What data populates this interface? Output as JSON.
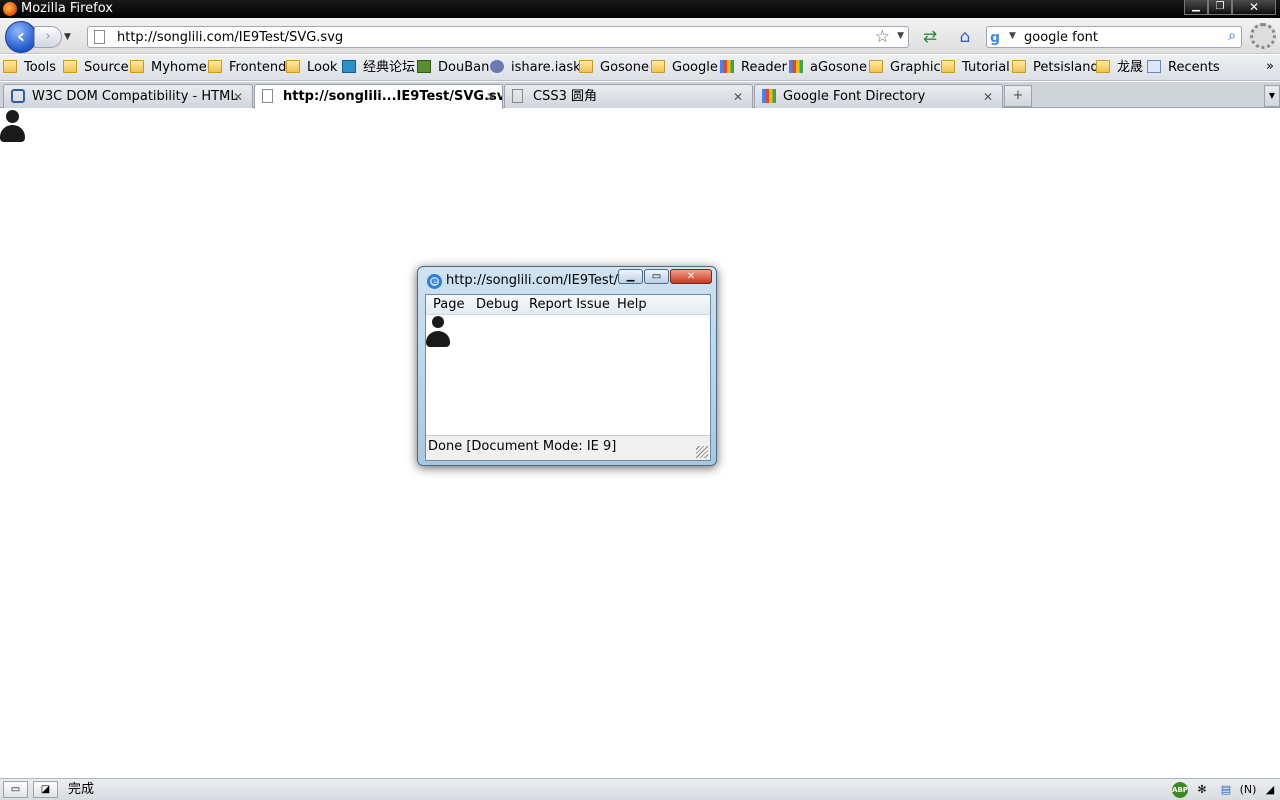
{
  "window": {
    "title": "Mozilla Firefox"
  },
  "nav": {
    "url": "http://songlili.com/IE9Test/SVG.svg",
    "search_text": "google font"
  },
  "bookmarks": [
    {
      "label": "Tools",
      "icon": "folder-icon"
    },
    {
      "label": "Source",
      "icon": "folder-icon"
    },
    {
      "label": "Myhome",
      "icon": "folder-icon"
    },
    {
      "label": "Frontend",
      "icon": "folder-icon"
    },
    {
      "label": "Look",
      "icon": "folder-icon"
    },
    {
      "label": "经典论坛",
      "icon": "site-icon"
    },
    {
      "label": "DouBan",
      "icon": "site-icon"
    },
    {
      "label": "ishare.iask",
      "icon": "site-icon"
    },
    {
      "label": "Gosone",
      "icon": "folder-icon"
    },
    {
      "label": "Google",
      "icon": "folder-icon"
    },
    {
      "label": "Reader",
      "icon": "google-icon"
    },
    {
      "label": "aGosone",
      "icon": "google-icon"
    },
    {
      "label": "Graphic",
      "icon": "folder-icon"
    },
    {
      "label": "Tutorial",
      "icon": "folder-icon"
    },
    {
      "label": "Petsisland",
      "icon": "folder-icon"
    },
    {
      "label": "龙晟",
      "icon": "folder-icon"
    },
    {
      "label": "Recents",
      "icon": "site-icon"
    }
  ],
  "tabs": [
    {
      "label": "W3C DOM Compatibility - HTML",
      "active": false
    },
    {
      "label": "http://songlili...IE9Test/SVG.svg",
      "active": true
    },
    {
      "label": "CSS3 圆角",
      "active": false
    },
    {
      "label": "Google Font Directory",
      "active": false
    }
  ],
  "ie_popup": {
    "title": "http://songlili.com/IE9Test/...",
    "menu": [
      "Page",
      "Debug",
      "Report Issue",
      "Help"
    ],
    "status": "Done [Document Mode: IE 9]"
  },
  "statusbar": {
    "text": "完成",
    "n_label": "(N)"
  }
}
